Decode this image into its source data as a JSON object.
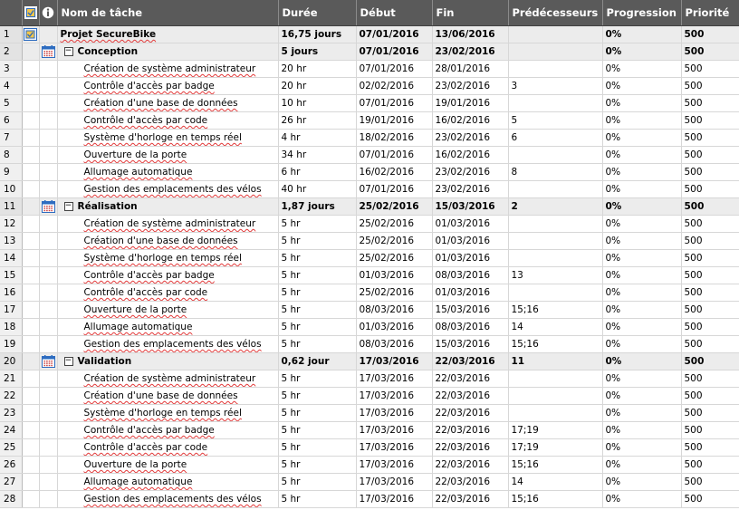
{
  "header": {
    "col_name": "Nom de tâche",
    "col_duration": "Durée",
    "col_start": "Début",
    "col_end": "Fin",
    "col_pred": "Prédécesseurs",
    "col_progress": "Progression",
    "col_priority": "Priorité"
  },
  "icons": {
    "indicator_header": "task-mode-icon",
    "info_header": "info-icon",
    "project": "project-summary-icon",
    "summary": "calendar-icon",
    "collapse": "collapse-toggle"
  },
  "colors": {
    "header_bg": "#5a5a5a",
    "summary_bg": "#ececec",
    "accent_blue": "#2d6cc0"
  },
  "rows": [
    {
      "n": "1",
      "name": "Projet SecureBike",
      "dur": "16,75 jours",
      "start": "07/01/2016",
      "end": "13/06/2016",
      "pred": "",
      "prog": "0%",
      "prio": "500",
      "level": 1,
      "summary": true,
      "project": true
    },
    {
      "n": "2",
      "name": "Conception",
      "dur": "5 jours",
      "start": "07/01/2016",
      "end": "23/02/2016",
      "pred": "",
      "prog": "0%",
      "prio": "500",
      "level": 2,
      "summary": true
    },
    {
      "n": "3",
      "name": "Création de système administrateur",
      "dur": "20 hr",
      "start": "07/01/2016",
      "end": "28/01/2016",
      "pred": "",
      "prog": "0%",
      "prio": "500",
      "level": 3
    },
    {
      "n": "4",
      "name": "Contrôle d'accès par badge",
      "dur": "20 hr",
      "start": "02/02/2016",
      "end": "23/02/2016",
      "pred": "3",
      "prog": "0%",
      "prio": "500",
      "level": 3
    },
    {
      "n": "5",
      "name": "Création d'une base de données",
      "dur": "10 hr",
      "start": "07/01/2016",
      "end": "19/01/2016",
      "pred": "",
      "prog": "0%",
      "prio": "500",
      "level": 3
    },
    {
      "n": "6",
      "name": "Contrôle d'accès par code",
      "dur": "26 hr",
      "start": "19/01/2016",
      "end": "16/02/2016",
      "pred": "5",
      "prog": "0%",
      "prio": "500",
      "level": 3
    },
    {
      "n": "7",
      "name": "Système d'horloge en temps réel",
      "dur": "4 hr",
      "start": "18/02/2016",
      "end": "23/02/2016",
      "pred": "6",
      "prog": "0%",
      "prio": "500",
      "level": 3
    },
    {
      "n": "8",
      "name": "Ouverture de la porte",
      "dur": "34 hr",
      "start": "07/01/2016",
      "end": "16/02/2016",
      "pred": "",
      "prog": "0%",
      "prio": "500",
      "level": 3
    },
    {
      "n": "9",
      "name": "Allumage automatique",
      "dur": "6 hr",
      "start": "16/02/2016",
      "end": "23/02/2016",
      "pred": "8",
      "prog": "0%",
      "prio": "500",
      "level": 3
    },
    {
      "n": "10",
      "name": "Gestion des emplacements des vélos",
      "dur": "40 hr",
      "start": "07/01/2016",
      "end": "23/02/2016",
      "pred": "",
      "prog": "0%",
      "prio": "500",
      "level": 3
    },
    {
      "n": "11",
      "name": "Réalisation",
      "dur": "1,87 jours",
      "start": "25/02/2016",
      "end": "15/03/2016",
      "pred": "2",
      "prog": "0%",
      "prio": "500",
      "level": 2,
      "summary": true
    },
    {
      "n": "12",
      "name": "Création de système administrateur",
      "dur": "5 hr",
      "start": "25/02/2016",
      "end": "01/03/2016",
      "pred": "",
      "prog": "0%",
      "prio": "500",
      "level": 3
    },
    {
      "n": "13",
      "name": "Création d'une base de données",
      "dur": "5 hr",
      "start": "25/02/2016",
      "end": "01/03/2016",
      "pred": "",
      "prog": "0%",
      "prio": "500",
      "level": 3
    },
    {
      "n": "14",
      "name": "Système d'horloge en temps réel",
      "dur": "5 hr",
      "start": "25/02/2016",
      "end": "01/03/2016",
      "pred": "",
      "prog": "0%",
      "prio": "500",
      "level": 3
    },
    {
      "n": "15",
      "name": "Contrôle d'accès par badge",
      "dur": "5 hr",
      "start": "01/03/2016",
      "end": "08/03/2016",
      "pred": "13",
      "prog": "0%",
      "prio": "500",
      "level": 3
    },
    {
      "n": "16",
      "name": "Contrôle d'accès par code",
      "dur": "5 hr",
      "start": "25/02/2016",
      "end": "01/03/2016",
      "pred": "",
      "prog": "0%",
      "prio": "500",
      "level": 3
    },
    {
      "n": "17",
      "name": "Ouverture de la porte",
      "dur": "5 hr",
      "start": "08/03/2016",
      "end": "15/03/2016",
      "pred": "15;16",
      "prog": "0%",
      "prio": "500",
      "level": 3
    },
    {
      "n": "18",
      "name": "Allumage automatique",
      "dur": "5 hr",
      "start": "01/03/2016",
      "end": "08/03/2016",
      "pred": "14",
      "prog": "0%",
      "prio": "500",
      "level": 3
    },
    {
      "n": "19",
      "name": "Gestion des emplacements des vélos",
      "dur": "5 hr",
      "start": "08/03/2016",
      "end": "15/03/2016",
      "pred": "15;16",
      "prog": "0%",
      "prio": "500",
      "level": 3
    },
    {
      "n": "20",
      "name": "Validation",
      "dur": "0,62 jour",
      "start": "17/03/2016",
      "end": "22/03/2016",
      "pred": "11",
      "prog": "0%",
      "prio": "500",
      "level": 2,
      "summary": true
    },
    {
      "n": "21",
      "name": "Création de système administrateur",
      "dur": "5 hr",
      "start": "17/03/2016",
      "end": "22/03/2016",
      "pred": "",
      "prog": "0%",
      "prio": "500",
      "level": 3
    },
    {
      "n": "22",
      "name": "Création d'une base de données",
      "dur": "5 hr",
      "start": "17/03/2016",
      "end": "22/03/2016",
      "pred": "",
      "prog": "0%",
      "prio": "500",
      "level": 3
    },
    {
      "n": "23",
      "name": "Système d'horloge en temps réel",
      "dur": "5 hr",
      "start": "17/03/2016",
      "end": "22/03/2016",
      "pred": "",
      "prog": "0%",
      "prio": "500",
      "level": 3
    },
    {
      "n": "24",
      "name": "Contrôle d'accès par badge",
      "dur": "5 hr",
      "start": "17/03/2016",
      "end": "22/03/2016",
      "pred": "17;19",
      "prog": "0%",
      "prio": "500",
      "level": 3
    },
    {
      "n": "25",
      "name": "Contrôle d'accès par code",
      "dur": "5 hr",
      "start": "17/03/2016",
      "end": "22/03/2016",
      "pred": "17;19",
      "prog": "0%",
      "prio": "500",
      "level": 3
    },
    {
      "n": "26",
      "name": "Ouverture de la porte",
      "dur": "5 hr",
      "start": "17/03/2016",
      "end": "22/03/2016",
      "pred": "15;16",
      "prog": "0%",
      "prio": "500",
      "level": 3
    },
    {
      "n": "27",
      "name": "Allumage automatique",
      "dur": "5 hr",
      "start": "17/03/2016",
      "end": "22/03/2016",
      "pred": "14",
      "prog": "0%",
      "prio": "500",
      "level": 3
    },
    {
      "n": "28",
      "name": "Gestion des emplacements des vélos",
      "dur": "5 hr",
      "start": "17/03/2016",
      "end": "22/03/2016",
      "pred": "15;16",
      "prog": "0%",
      "prio": "500",
      "level": 3
    }
  ]
}
